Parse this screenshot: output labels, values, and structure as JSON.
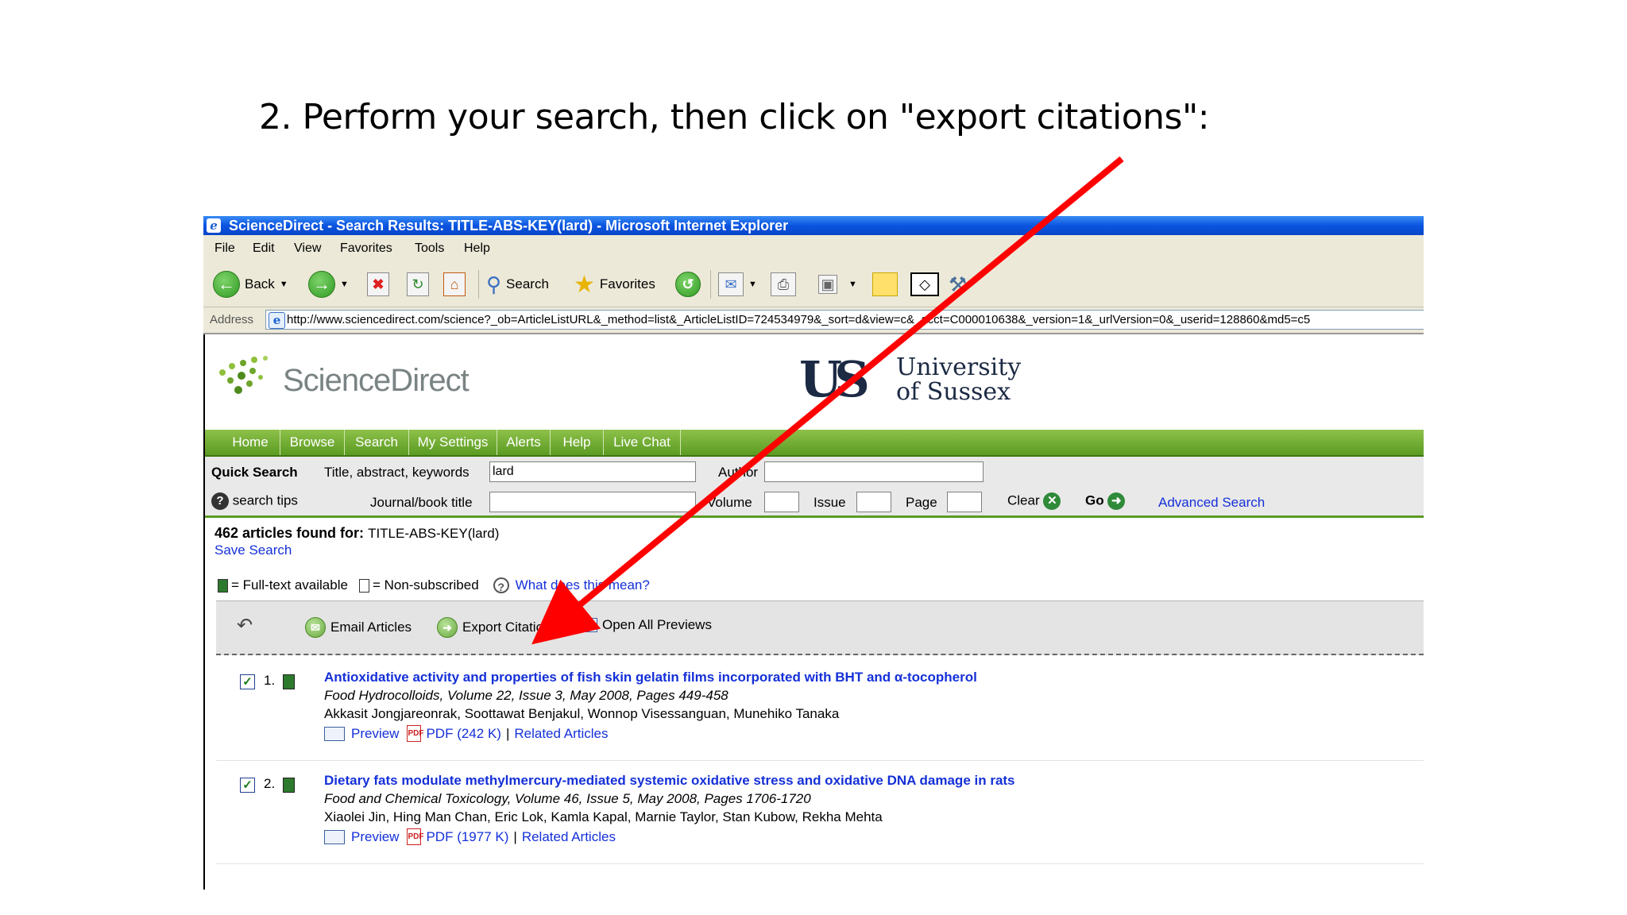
{
  "slide": {
    "title": "2. Perform your search, then click on \"export citations\":"
  },
  "browser": {
    "window_title": "ScienceDirect - Search Results: TITLE-ABS-KEY(lard) - Microsoft Internet Explorer",
    "menu": [
      "File",
      "Edit",
      "View",
      "Favorites",
      "Tools",
      "Help"
    ],
    "toolbar": {
      "back_label": "Back",
      "search_label": "Search",
      "favorites_label": "Favorites"
    },
    "address": {
      "label": "Address",
      "url": "http://www.sciencedirect.com/science?_ob=ArticleListURL&_method=list&_ArticleListID=724534979&_sort=d&view=c&_acct=C000010638&_version=1&_urlVersion=0&_userid=128860&md5=c5"
    }
  },
  "site": {
    "logo_text": "ScienceDirect",
    "institution_mark": "US",
    "institution_line1": "University",
    "institution_line2": "of Sussex",
    "nav": [
      "Home",
      "Browse",
      "Search",
      "My Settings",
      "Alerts",
      "Help",
      "Live Chat"
    ]
  },
  "quick_search": {
    "heading": "Quick Search",
    "search_tips": "search tips",
    "title_label": "Title, abstract, keywords",
    "title_value": "lard",
    "author_label": "Author",
    "journal_label": "Journal/book title",
    "volume_label": "Volume",
    "issue_label": "Issue",
    "page_label": "Page",
    "clear_label": "Clear",
    "go_label": "Go",
    "advanced_label": "Advanced Search"
  },
  "results": {
    "count_text": "462 articles found for:",
    "query_text": "TITLE-ABS-KEY(lard)",
    "save_search": "Save Search",
    "legend_full": "= Full-text available",
    "legend_non": "= Non-subscribed",
    "legend_help": "What does this mean?",
    "actions": {
      "email": "Email Articles",
      "export": "Export Citations",
      "open_previews": "Open All Previews"
    },
    "items": [
      {
        "num": "1.",
        "title": "Antioxidative activity and properties of fish skin gelatin films incorporated with BHT and α-tocopherol",
        "source": "Food Hydrocolloids, Volume 22, Issue 3, May 2008, Pages 449-458",
        "authors": "Akkasit Jongjareonrak, Soottawat Benjakul, Wonnop Visessanguan, Munehiko Tanaka",
        "preview": "Preview",
        "pdf": "PDF (242 K)",
        "related": "Related Articles"
      },
      {
        "num": "2.",
        "title": "Dietary fats modulate methylmercury-mediated systemic oxidative stress and oxidative DNA damage in rats",
        "source": "Food and Chemical Toxicology, Volume 46, Issue 5, May 2008, Pages 1706-1720",
        "authors": "Xiaolei Jin, Hing Man Chan, Eric Lok, Kamla Kapal, Marnie Taylor, Stan Kubow, Rekha Mehta",
        "preview": "Preview",
        "pdf": "PDF (1977 K)",
        "related": "Related Articles"
      }
    ]
  },
  "colors": {
    "arrow": "#ff0000",
    "nav_green": "#6aa832",
    "link_blue": "#1530d8"
  }
}
